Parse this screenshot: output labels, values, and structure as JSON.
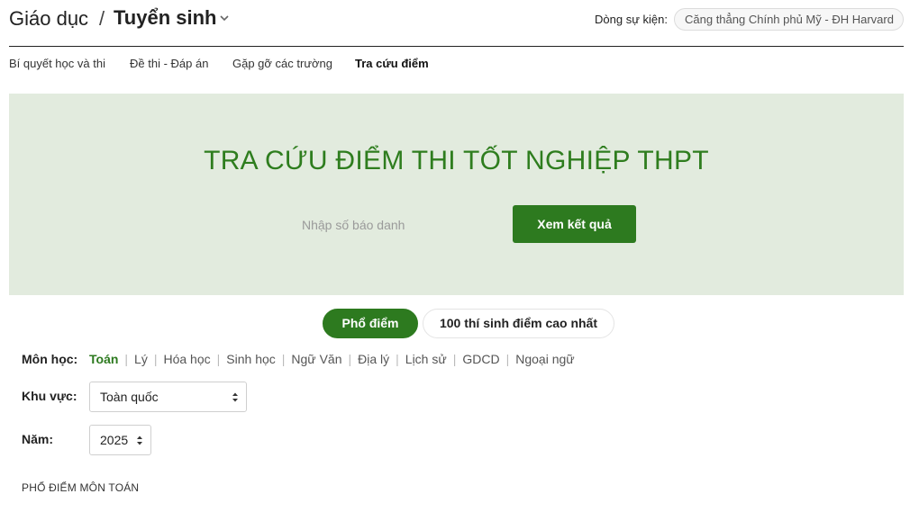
{
  "header": {
    "breadcrumb_parent": "Giáo dục",
    "breadcrumb_separator": "/",
    "breadcrumb_current": "Tuyển sinh",
    "event_label": "Dòng sự kiện:",
    "event_chip": "Căng thẳng Chính phủ Mỹ - ĐH Harvard"
  },
  "subnav": {
    "items": [
      {
        "label": "Bí quyết học và thi",
        "active": false
      },
      {
        "label": "Đề thi - Đáp án",
        "active": false
      },
      {
        "label": "Gặp gỡ các trường",
        "active": false
      },
      {
        "label": "Tra cứu điểm",
        "active": true
      }
    ]
  },
  "hero": {
    "title": "TRA CỨU ĐIỂM THI TỐT NGHIỆP THPT",
    "input_placeholder": "Nhập số báo danh",
    "input_value": "",
    "button_label": "Xem kết quả"
  },
  "tabs": [
    {
      "label": "Phổ điểm",
      "active": true
    },
    {
      "label": "100 thí sinh điểm cao nhất",
      "active": false
    }
  ],
  "filters": {
    "subject_label": "Môn học:",
    "subjects": [
      "Toán",
      "Lý",
      "Hóa học",
      "Sinh học",
      "Ngữ Văn",
      "Địa lý",
      "Lịch sử",
      "GDCD",
      "Ngoại ngữ"
    ],
    "selected_subject": "Toán",
    "region_label": "Khu vực:",
    "region_value": "Toàn quốc",
    "year_label": "Năm:",
    "year_value": "2025"
  },
  "section_title": "PHỔ ĐIỂM MÔN TOÁN",
  "colors": {
    "accent": "#2d7a1f",
    "hero_background": "#e2ebde",
    "title_green": "#2e7d1e"
  }
}
